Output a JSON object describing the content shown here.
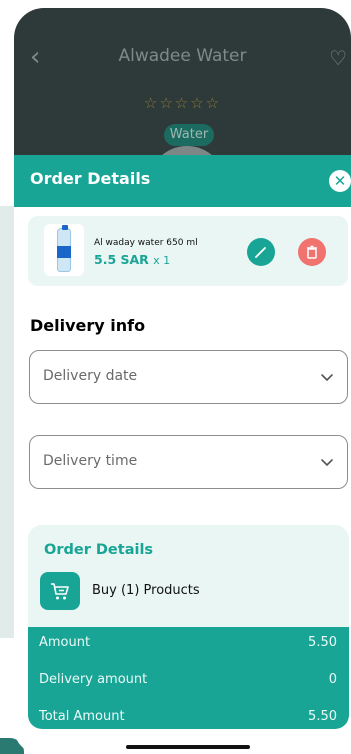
{
  "background_screen": {
    "title": "Alwadee Water",
    "back_icon": "chevron-left-icon",
    "heart_icon": "heart-icon",
    "stars": "☆☆☆☆☆",
    "tag": "Water"
  },
  "order_sheet": {
    "title": "Order Details",
    "close_icon": "close-icon",
    "product": {
      "name": "Al waday water 650 ml",
      "price": "5.5 SAR",
      "quantity": "x 1"
    },
    "delivery_title": "Delivery info",
    "delivery_date_placeholder": "Delivery date",
    "delivery_time_placeholder": "Delivery time",
    "summary": {
      "title": "Order Details",
      "buy_text": "Buy (1) Products",
      "rows": [
        {
          "label": "Amount",
          "value": "5.50"
        },
        {
          "label": "Delivery amount",
          "value": "0"
        },
        {
          "label": "Total Amount",
          "value": "5.50"
        }
      ]
    }
  },
  "colors": {
    "accent": "#19a596",
    "delete": "#f0736f",
    "card_bg": "#e9f6f4"
  }
}
